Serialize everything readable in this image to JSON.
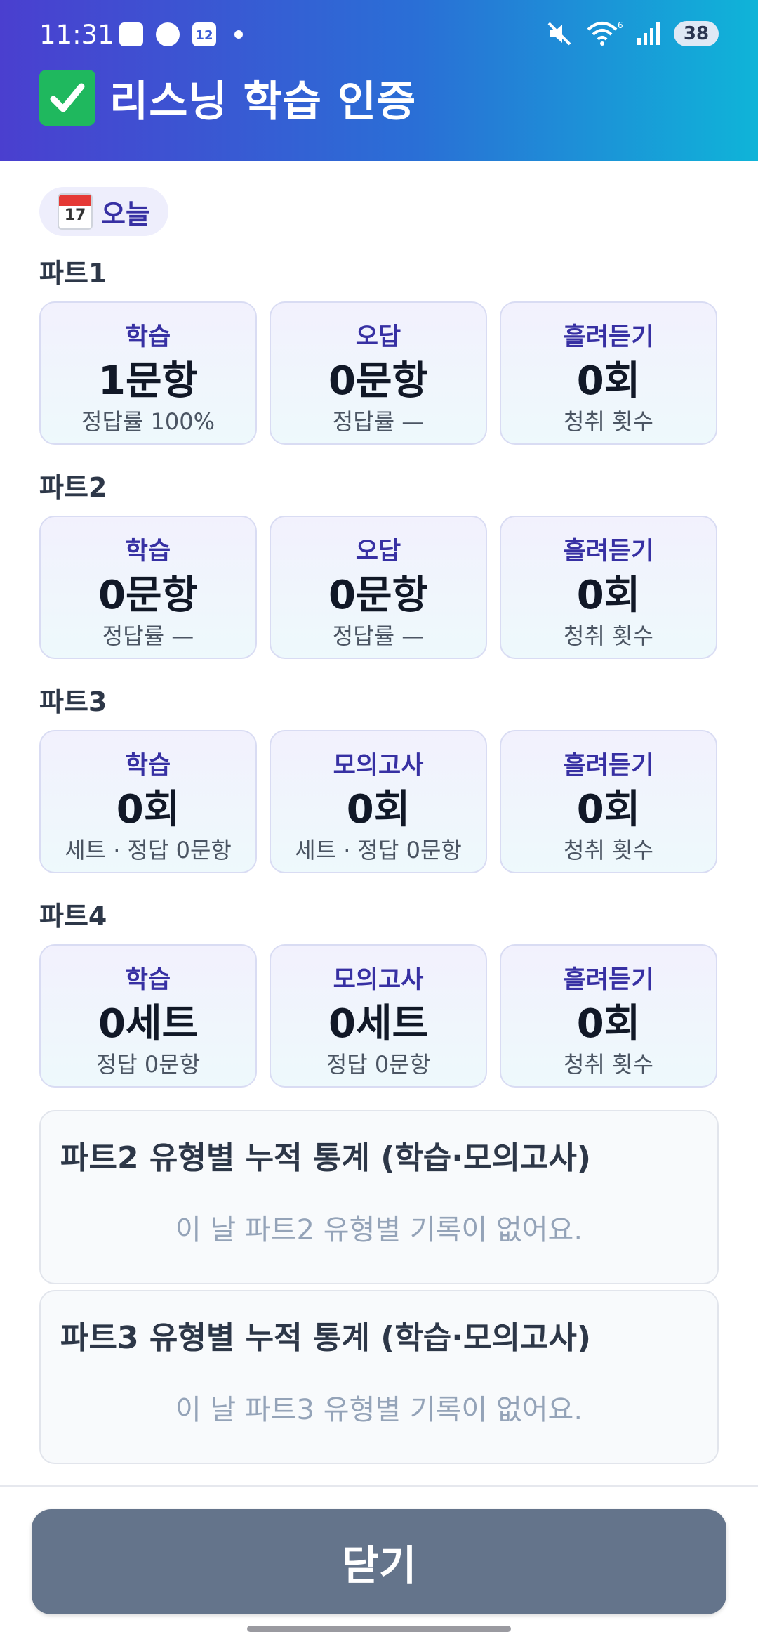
{
  "status": {
    "time": "11:31",
    "calendar_day": "12",
    "network_label": "6",
    "battery": "38"
  },
  "header": {
    "title": "리스닝 학습 인증"
  },
  "date_chip": {
    "calendar_day": "17",
    "label": "오늘"
  },
  "parts": [
    {
      "label": "파트1",
      "cards": [
        {
          "title": "학습",
          "value": "1문항",
          "sub": "정답률 100%"
        },
        {
          "title": "오답",
          "value": "0문항",
          "sub": "정답률 —"
        },
        {
          "title": "흘려듣기",
          "value": "0회",
          "sub": "청취 횟수"
        }
      ]
    },
    {
      "label": "파트2",
      "cards": [
        {
          "title": "학습",
          "value": "0문항",
          "sub": "정답률 —"
        },
        {
          "title": "오답",
          "value": "0문항",
          "sub": "정답률 —"
        },
        {
          "title": "흘려듣기",
          "value": "0회",
          "sub": "청취 횟수"
        }
      ]
    },
    {
      "label": "파트3",
      "cards": [
        {
          "title": "학습",
          "value": "0회",
          "sub": "세트 · 정답 0문항"
        },
        {
          "title": "모의고사",
          "value": "0회",
          "sub": "세트 · 정답 0문항"
        },
        {
          "title": "흘려듣기",
          "value": "0회",
          "sub": "청취 횟수"
        }
      ]
    },
    {
      "label": "파트4",
      "cards": [
        {
          "title": "학습",
          "value": "0세트",
          "sub": "정답 0문항"
        },
        {
          "title": "모의고사",
          "value": "0세트",
          "sub": "정답 0문항"
        },
        {
          "title": "흘려듣기",
          "value": "0회",
          "sub": "청취 횟수"
        }
      ]
    }
  ],
  "stats": [
    {
      "title": "파트2 유형별 누적 통계 (학습·모의고사)",
      "empty": "이 날 파트2 유형별 기록이 없어요."
    },
    {
      "title": "파트3 유형별 누적 통계 (학습·모의고사)",
      "empty": "이 날 파트3 유형별 기록이 없어요."
    }
  ],
  "footer": {
    "close_label": "닫기"
  },
  "colors": {
    "accent": "#3730a3",
    "header_start": "#4a3fcf",
    "header_end": "#0fb4d8",
    "button": "#64748b"
  }
}
